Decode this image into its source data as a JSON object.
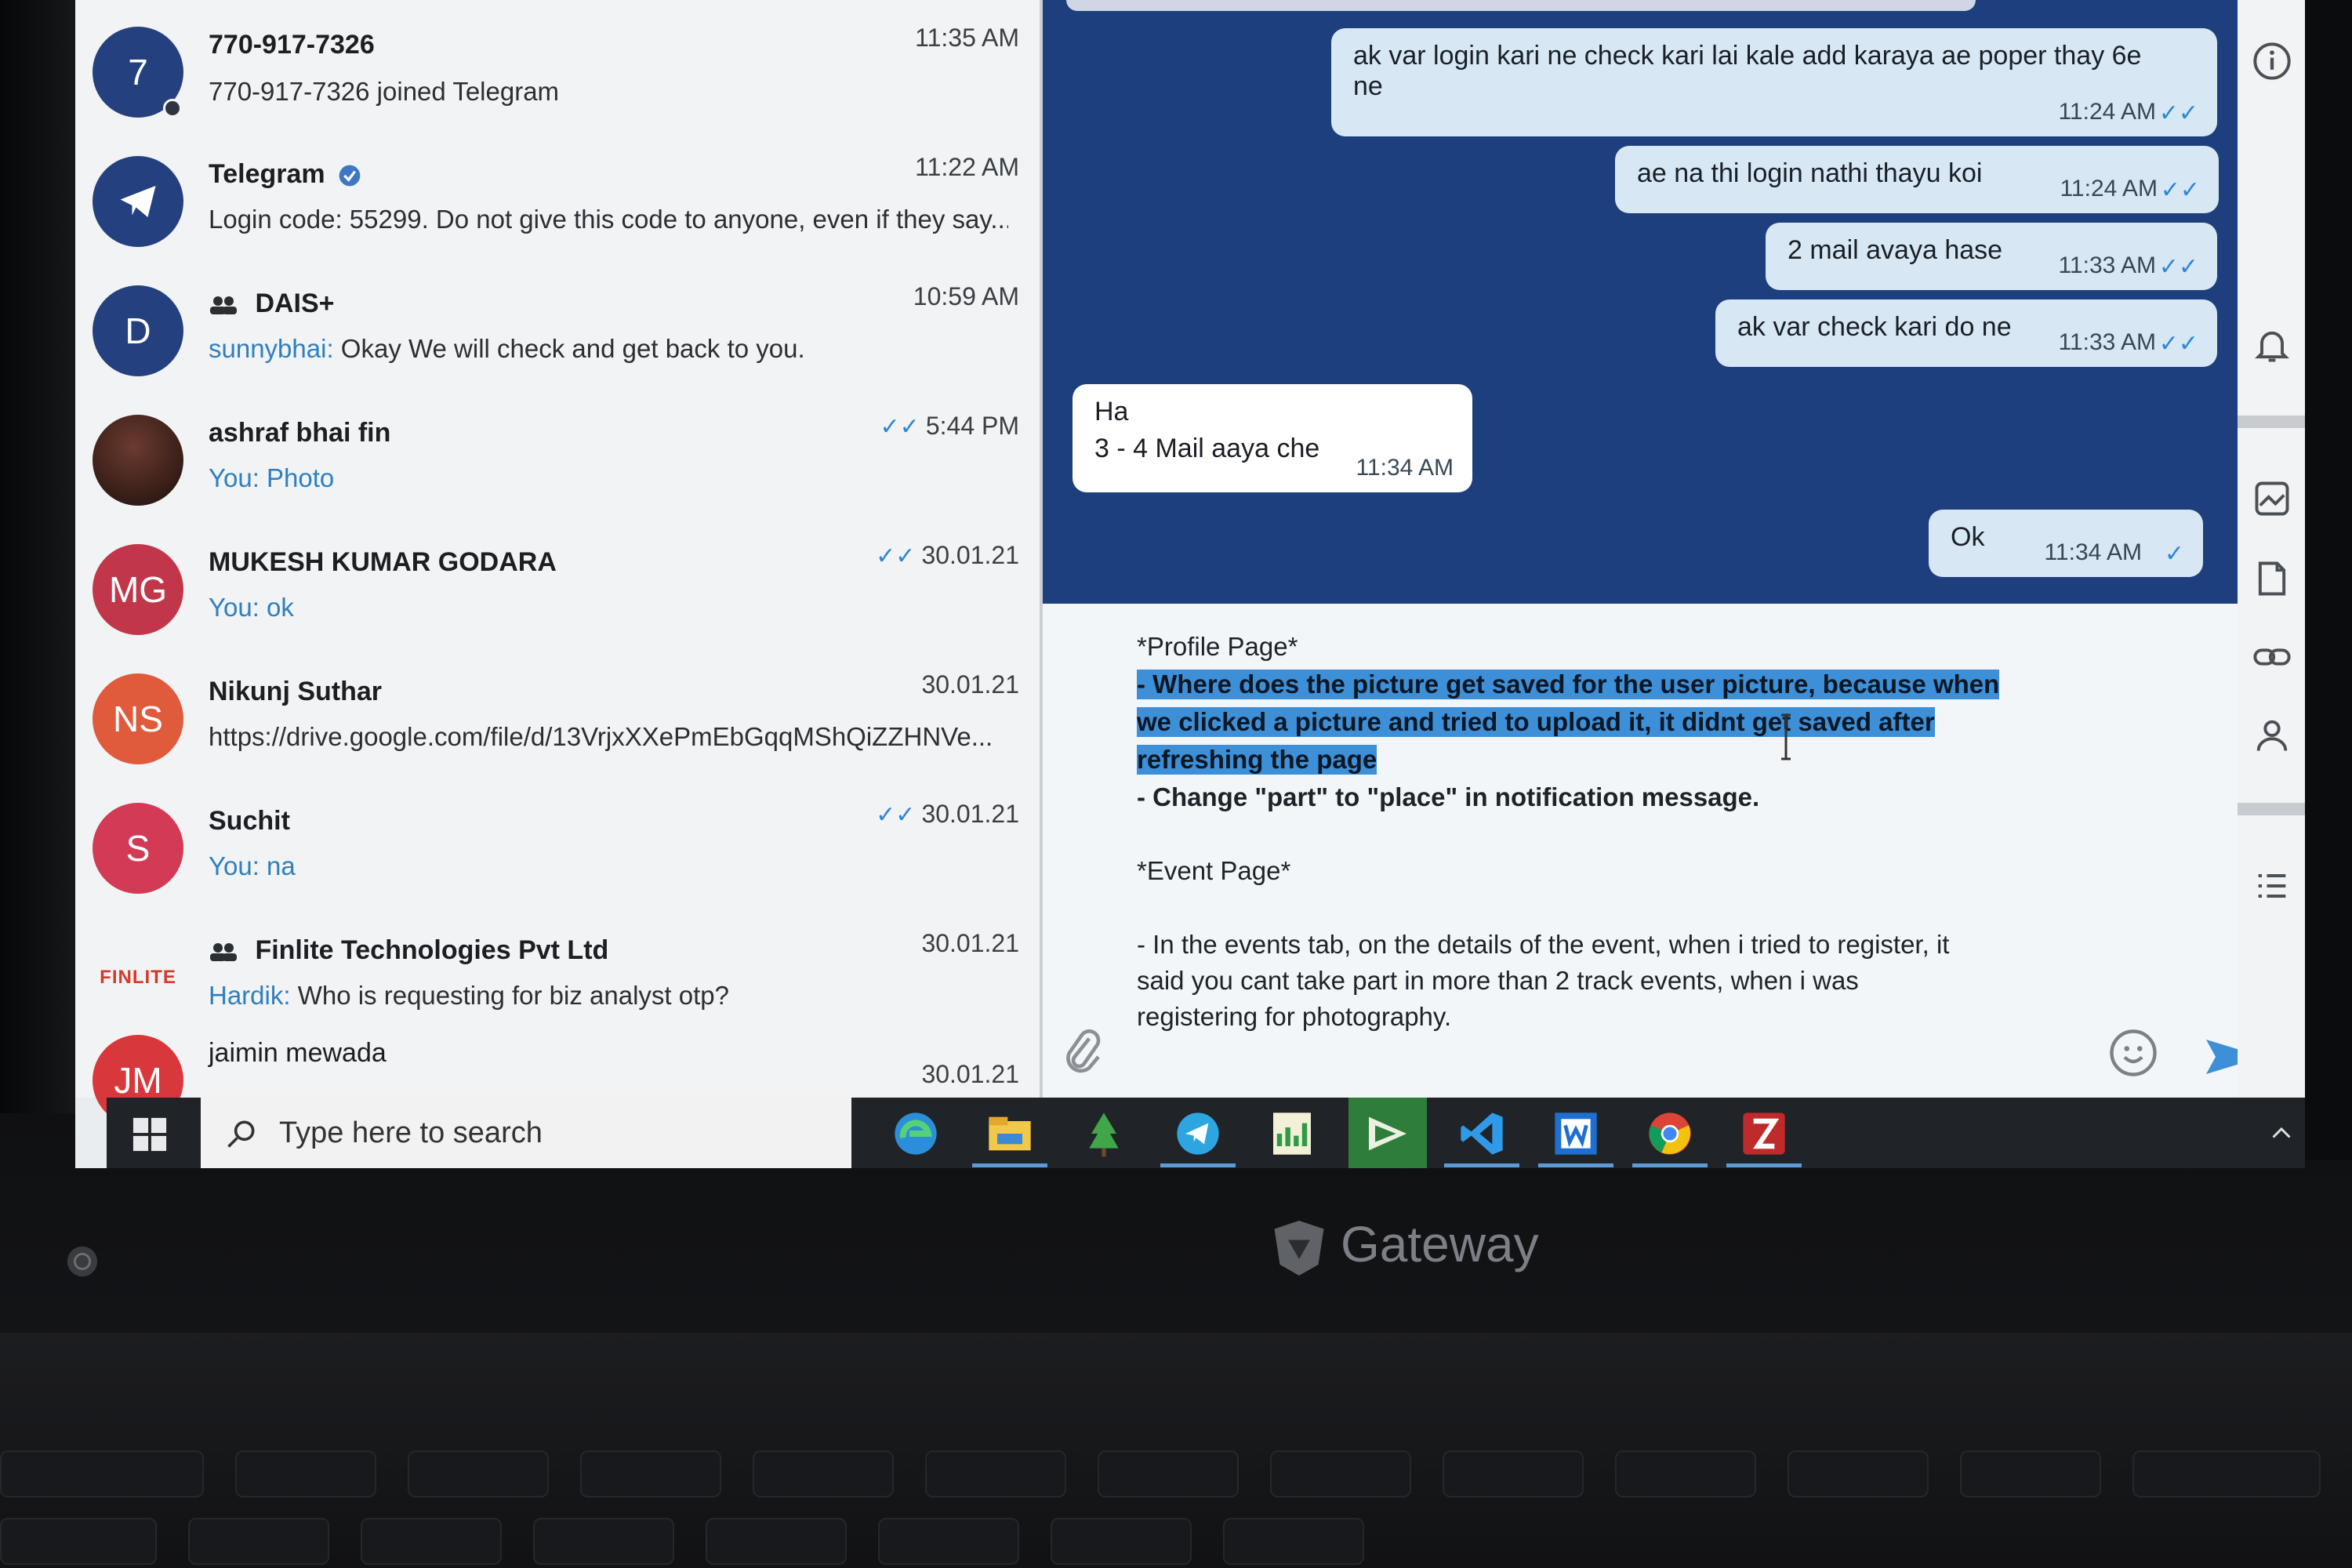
{
  "chats": [
    {
      "avatar_text": "7",
      "avatar_color": "#24407e",
      "name": "770-917-7326",
      "time": "11:35 AM",
      "sender": "",
      "preview": "770-917-7326 joined Telegram",
      "ticks": "",
      "group": false,
      "verified": false
    },
    {
      "avatar_text": "",
      "avatar_icon": "telegram-plane-icon",
      "avatar_color": "#24407e",
      "name": "Telegram",
      "time": "11:22 AM",
      "sender": "",
      "preview": "Login code: 55299. Do not give this code to anyone, even if they say...",
      "ticks": "",
      "group": false,
      "verified": true
    },
    {
      "avatar_text": "D",
      "avatar_color": "#24407e",
      "name": "DAIS+",
      "time": "10:59 AM",
      "sender": "sunnybhai:",
      "preview": " Okay We will check and get back to you.",
      "ticks": "",
      "group": true,
      "verified": false
    },
    {
      "avatar_text": "",
      "avatar_color": "#3a1f1c",
      "name": "ashraf bhai fin",
      "time": "5:44 PM",
      "sender": "You:",
      "preview": " Photo",
      "ticks": "✓✓",
      "group": false,
      "verified": false
    },
    {
      "avatar_text": "MG",
      "avatar_color": "#c2364a",
      "name": "MUKESH KUMAR GODARA",
      "time": "30.01.21",
      "sender": "You:",
      "preview": " ok",
      "ticks": "✓✓",
      "group": false,
      "verified": false
    },
    {
      "avatar_text": "NS",
      "avatar_color": "#e05a3c",
      "name": "Nikunj Suthar",
      "time": "30.01.21",
      "sender": "",
      "preview": "https://drive.google.com/file/d/13VrjxXXePmEbGqqMShQiZZHNVe...",
      "ticks": "",
      "group": false,
      "verified": false
    },
    {
      "avatar_text": "S",
      "avatar_color": "#d23a56",
      "name": "Suchit",
      "time": "30.01.21",
      "sender": "You:",
      "preview": " na",
      "ticks": "✓✓",
      "group": false,
      "verified": false
    },
    {
      "avatar_text": "FINLITE",
      "avatar_color": "#f1f3f4",
      "name": "Finlite Technologies Pvt Ltd",
      "time": "30.01.21",
      "sender": "Hardik:",
      "preview": " Who is requesting for biz analyst otp?",
      "ticks": "",
      "group": true,
      "verified": false
    },
    {
      "avatar_text": "JM",
      "avatar_color": "#d8373b",
      "name": "jaimin mewada",
      "time": "30.01.21",
      "sender": "",
      "preview": "",
      "ticks": "",
      "group": false,
      "verified": false
    }
  ],
  "messages": [
    {
      "dir": "out",
      "line1": "ak var login kari ne check kari lai kale add karaya ae poper thay 6e",
      "line2": "ne",
      "time": "11:24 AM",
      "check": "✓✓"
    },
    {
      "dir": "out",
      "line1": "ae na thi login nathi thayu koi",
      "line2": "",
      "time": "11:24 AM",
      "check": "✓✓"
    },
    {
      "dir": "out",
      "line1": "2 mail avaya hase",
      "line2": "",
      "time": "11:33 AM",
      "check": "✓✓"
    },
    {
      "dir": "out",
      "line1": "ak var check kari do ne",
      "line2": "",
      "time": "11:33 AM",
      "check": "✓✓"
    },
    {
      "dir": "in",
      "line1": "Ha",
      "line2": "3 - 4 Mail aaya che",
      "time": "11:34 AM",
      "check": ""
    },
    {
      "dir": "out",
      "line1": "Ok",
      "line2": "",
      "time": "11:34 AM",
      "check": "✓"
    }
  ],
  "compose": {
    "profile_heading": "*Profile Page*",
    "hl_line1": "- Where does the picture get saved for the user picture, because when",
    "hl_line2": "we clicked a picture and tried to upload it, it didnt get saved after",
    "hl_line3": "refreshing the page",
    "change_line": "- Change \"part\" to \"place\" in notification message.",
    "event_heading": "*Event Page*",
    "event_line1": "- In the events tab, on the details of the event, when i tried to register, it",
    "event_line2": "said you cant take part in more than 2 track events, when i was",
    "event_line3": "registering for photography."
  },
  "taskbar": {
    "search_placeholder": "Type here to search",
    "apps": [
      "edge-icon",
      "file-explorer-icon",
      "tree-app-icon",
      "telegram-icon",
      "spreadsheet-icon",
      "media-player-icon",
      "vscode-icon",
      "webstorm-icon",
      "chrome-icon",
      "filezilla-icon"
    ]
  },
  "hardware": {
    "brand": "Gateway"
  },
  "colors": {
    "chat_bg": "#1e3f7d",
    "accent": "#2f86d3",
    "highlight": "#3d8fd8"
  }
}
